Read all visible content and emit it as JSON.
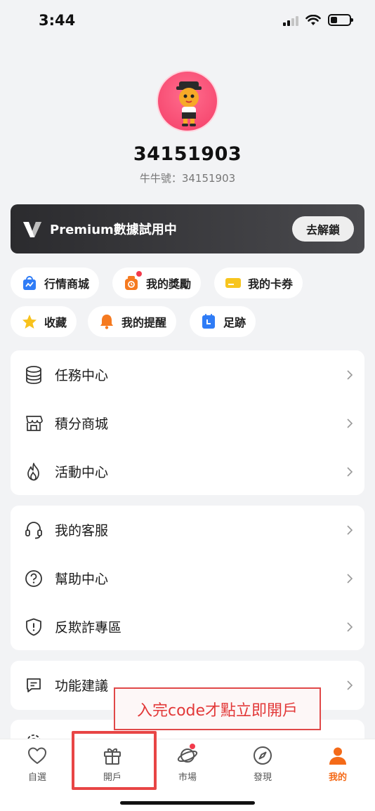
{
  "status": {
    "time": "3:44"
  },
  "profile": {
    "name": "34151903",
    "id_label": "牛牛號：34151903"
  },
  "premium": {
    "text": "Premium數據試用中",
    "button": "去解鎖"
  },
  "chips": [
    {
      "label": "行情商城",
      "icon": "market-bag-icon"
    },
    {
      "label": "我的獎勵",
      "icon": "reward-icon",
      "badge": true
    },
    {
      "label": "我的卡券",
      "icon": "coupon-icon"
    },
    {
      "label": "收藏",
      "icon": "star-icon"
    },
    {
      "label": "我的提醒",
      "icon": "bell-icon"
    },
    {
      "label": "足跡",
      "icon": "footprint-icon"
    }
  ],
  "card1": [
    {
      "label": "任務中心",
      "icon": "database-icon"
    },
    {
      "label": "積分商城",
      "icon": "store-icon"
    },
    {
      "label": "活動中心",
      "icon": "flame-icon"
    }
  ],
  "card2": [
    {
      "label": "我的客服",
      "icon": "headset-icon"
    },
    {
      "label": "幫助中心",
      "icon": "help-icon"
    },
    {
      "label": "反欺詐專區",
      "icon": "shield-icon"
    }
  ],
  "card3": [
    {
      "label": "功能建議",
      "icon": "message-icon"
    }
  ],
  "annotation": {
    "text": "入完code才點立即開戶"
  },
  "tabs": [
    {
      "label": "自選",
      "icon": "heart-icon"
    },
    {
      "label": "開戶",
      "icon": "gift-icon"
    },
    {
      "label": "市場",
      "icon": "planet-icon",
      "badge": true
    },
    {
      "label": "發現",
      "icon": "compass-icon"
    },
    {
      "label": "我的",
      "icon": "person-icon",
      "active": true
    }
  ],
  "colors": {
    "accent": "#f46a18",
    "badge": "#f23b4c",
    "annotation": "#e23838"
  }
}
